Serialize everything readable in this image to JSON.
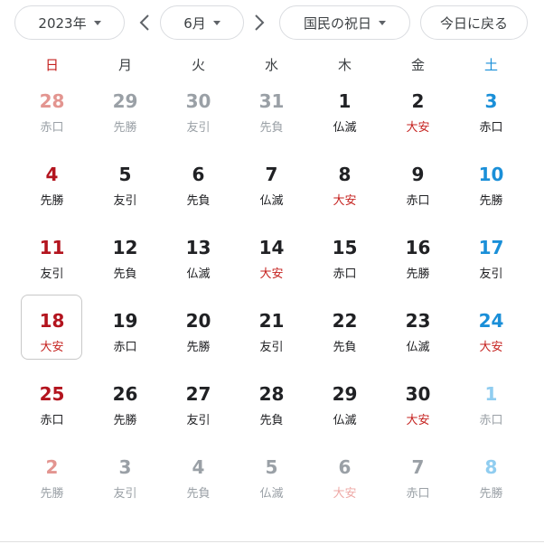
{
  "toolbar": {
    "year_label": "2023年",
    "month_label": "6月",
    "holiday_label": "国民の祝日",
    "today_label": "今日に戻る"
  },
  "weekdays": [
    "日",
    "月",
    "火",
    "水",
    "木",
    "金",
    "土"
  ],
  "colors": {
    "sunday": "#b3141e",
    "saturday": "#1a8fd8",
    "taian": "#c5221f",
    "muted": "#9aa0a6",
    "today_border": "#c8c8c8"
  },
  "weeks": [
    [
      {
        "d": "28",
        "r": "赤口",
        "other": true
      },
      {
        "d": "29",
        "r": "先勝",
        "other": true
      },
      {
        "d": "30",
        "r": "友引",
        "other": true
      },
      {
        "d": "31",
        "r": "先負",
        "other": true
      },
      {
        "d": "1",
        "r": "仏滅",
        "other": false
      },
      {
        "d": "2",
        "r": "大安",
        "other": false
      },
      {
        "d": "3",
        "r": "赤口",
        "other": false
      }
    ],
    [
      {
        "d": "4",
        "r": "先勝",
        "other": false
      },
      {
        "d": "5",
        "r": "友引",
        "other": false
      },
      {
        "d": "6",
        "r": "先負",
        "other": false
      },
      {
        "d": "7",
        "r": "仏滅",
        "other": false
      },
      {
        "d": "8",
        "r": "大安",
        "other": false
      },
      {
        "d": "9",
        "r": "赤口",
        "other": false
      },
      {
        "d": "10",
        "r": "先勝",
        "other": false
      }
    ],
    [
      {
        "d": "11",
        "r": "友引",
        "other": false
      },
      {
        "d": "12",
        "r": "先負",
        "other": false
      },
      {
        "d": "13",
        "r": "仏滅",
        "other": false
      },
      {
        "d": "14",
        "r": "大安",
        "other": false
      },
      {
        "d": "15",
        "r": "赤口",
        "other": false
      },
      {
        "d": "16",
        "r": "先勝",
        "other": false
      },
      {
        "d": "17",
        "r": "友引",
        "other": false
      }
    ],
    [
      {
        "d": "18",
        "r": "大安",
        "other": false,
        "today": true
      },
      {
        "d": "19",
        "r": "赤口",
        "other": false
      },
      {
        "d": "20",
        "r": "先勝",
        "other": false
      },
      {
        "d": "21",
        "r": "友引",
        "other": false
      },
      {
        "d": "22",
        "r": "先負",
        "other": false
      },
      {
        "d": "23",
        "r": "仏滅",
        "other": false
      },
      {
        "d": "24",
        "r": "大安",
        "other": false
      }
    ],
    [
      {
        "d": "25",
        "r": "赤口",
        "other": false
      },
      {
        "d": "26",
        "r": "先勝",
        "other": false
      },
      {
        "d": "27",
        "r": "友引",
        "other": false
      },
      {
        "d": "28",
        "r": "先負",
        "other": false
      },
      {
        "d": "29",
        "r": "仏滅",
        "other": false
      },
      {
        "d": "30",
        "r": "大安",
        "other": false
      },
      {
        "d": "1",
        "r": "赤口",
        "other": true
      }
    ],
    [
      {
        "d": "2",
        "r": "先勝",
        "other": true
      },
      {
        "d": "3",
        "r": "友引",
        "other": true
      },
      {
        "d": "4",
        "r": "先負",
        "other": true
      },
      {
        "d": "5",
        "r": "仏滅",
        "other": true
      },
      {
        "d": "6",
        "r": "大安",
        "other": true
      },
      {
        "d": "7",
        "r": "赤口",
        "other": true
      },
      {
        "d": "8",
        "r": "先勝",
        "other": true
      }
    ]
  ]
}
